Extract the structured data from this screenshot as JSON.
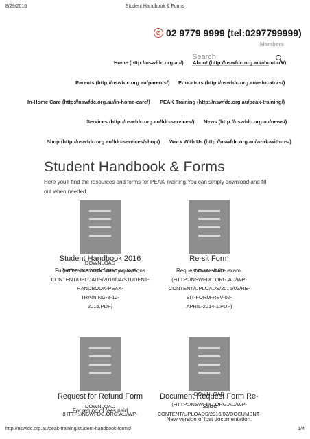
{
  "print_header": {
    "date": "8/29/2016",
    "title": "Student Handbook & Forms"
  },
  "contact": {
    "phone": "02 9779 9999 (tel:0297799999)"
  },
  "members_label": "Members",
  "search": {
    "placeholder": "Search"
  },
  "nav": {
    "home": "Home (http://nswfdc.org.au/)",
    "about": "About (http://nswfdc.org.au/about-us/)",
    "parents": "Parents (http://nswfdc.org.au/parents/)",
    "educators": "Educators (http://nswfdc.org.au/educators/)",
    "inhome": "In-Home Care (http://nswfdc.org.au/in-home-care/)",
    "peak": "PEAK Training (http://nswfdc.org.au/peak-training/)",
    "services": "Services (http://nswfdc.org.au/fdc-services/)",
    "news": "News (http://nswfdc.org.au/news/)",
    "shop": "Shop (http://nswfdc.org.au/fdc-services/shop/)",
    "work": "Work With Us (http://nswfdc.org.au/work-with-us/)"
  },
  "page": {
    "title": "Student Handbook & Forms",
    "intro": "Here you'll find the resources and forms for PEAK Training.You can simply download and fill out when needed."
  },
  "cards": [
    {
      "title": "Student Handbook 2016",
      "desc": "Full reference book for any questions",
      "download": "DOWNLOAD",
      "link_lines": [
        "(HTTP://NSWFDC.ORG.AU/WP-",
        "CONTENT/UPLOADS/2016/04/STUDENT-",
        "HANDBOOK-PEAK-",
        "TRAINING-8-12-",
        "2015.PDF)"
      ]
    },
    {
      "title": "Re-sit Form",
      "desc": "Request to re-sit the exam.",
      "download": "DOWNLOAD",
      "link_lines": [
        "(HTTP://NSWFDC.ORG.AU/WP-",
        "CONTENT/UPLOADS/2016/02/RE-",
        "SIT-FORM-REV-02-",
        "APRIL-2014-1.PDF)"
      ]
    },
    {
      "title": "Request for Refund Form",
      "desc": "For refund of fees paid",
      "download": "DOWNLOAD",
      "link_lines": [
        "(HTTP://NSWFDC.ORG.AU/WP-"
      ]
    },
    {
      "title": "Document Request Form Re-",
      "title_line2": "issue",
      "desc": "New version of lost documentation.",
      "download": "DOWNLOAD",
      "link_lines": [
        "(HTTP://NSWFDC.ORG.AU/WP-",
        "CONTENT/UPLOADS/2016/02/DOCUMENT-"
      ]
    }
  ],
  "print_footer": {
    "url": "http://nswfdc.org.au/peak-training/student-handbook-forms/",
    "page": "1/4"
  }
}
